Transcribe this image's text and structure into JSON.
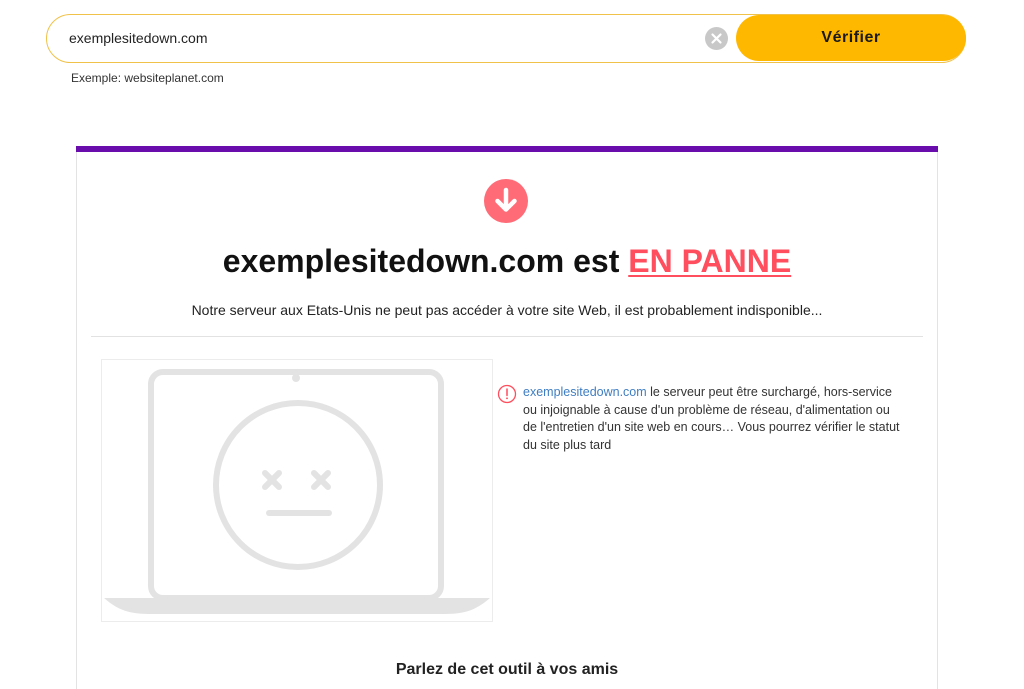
{
  "search": {
    "value": "exemplesitedown.com",
    "verify_label": "Vérifier",
    "example_hint": "Exemple: websiteplanet.com"
  },
  "result": {
    "domain": "exemplesitedown.com",
    "status_prefix": "est",
    "status": "EN PANNE",
    "subtitle": "Notre serveur aux Etats-Unis ne peut pas accéder à votre site Web, il est probablement indisponible...",
    "error_domain": "exemplesitedown.com",
    "error_text": "le serveur peut être surchargé, hors-service ou injoignable à cause d'un problème de réseau, d'alimentation ou de l'entretien d'un site web en cours… Vous pourrez vérifier le statut du site plus tard"
  },
  "share": {
    "title": "Parlez de cet outil à vos amis"
  },
  "icons": {
    "clear": "clear-icon",
    "down": "arrow-down-icon",
    "error": "exclamation-circle-icon",
    "illustration": "sad-laptop-illustration"
  },
  "colors": {
    "accent_button": "#ffb800",
    "search_border": "#f0c24a",
    "card_bar": "#6a0dad",
    "status_red": "#ff4f5e",
    "link_blue": "#3f7ec2"
  }
}
